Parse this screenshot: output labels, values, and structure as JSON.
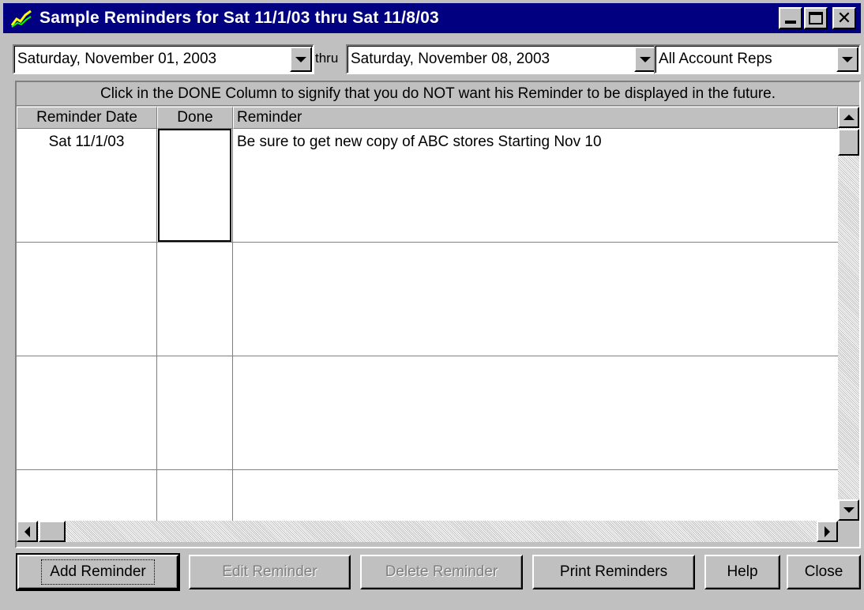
{
  "window": {
    "title": "Sample Reminders for Sat 11/1/03 thru Sat 11/8/03",
    "icon": "chart-line-icon"
  },
  "filters": {
    "start_date": "Saturday, November 01, 2003",
    "thru_label": "thru",
    "end_date": "Saturday, November 08, 2003",
    "account_rep": "All Account Reps"
  },
  "grid": {
    "caption": "Click in the DONE Column to signify that you do NOT want his Reminder to be displayed in the future.",
    "columns": [
      "Reminder Date",
      "Done",
      "Reminder"
    ],
    "rows": [
      {
        "date": "Sat 11/1/03",
        "done": "",
        "reminder": "Be sure to get new copy of ABC stores Starting Nov 10"
      },
      {
        "date": "",
        "done": "",
        "reminder": ""
      },
      {
        "date": "",
        "done": "",
        "reminder": ""
      },
      {
        "date": "",
        "done": "",
        "reminder": ""
      }
    ]
  },
  "buttons": {
    "add": "Add Reminder",
    "edit": "Edit Reminder",
    "delete": "Delete Reminder",
    "print": "Print Reminders",
    "help": "Help",
    "close": "Close"
  },
  "colors": {
    "titlebar": "#000080",
    "face": "#c0c0c0"
  }
}
